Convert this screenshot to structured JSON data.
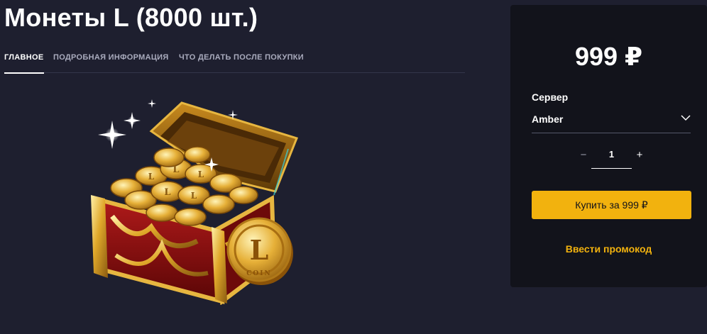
{
  "product": {
    "title": "Монеты L (8000 шт.)",
    "image_alt": "Сундук с монетами L"
  },
  "tabs": [
    {
      "label": "ГЛАВНОЕ",
      "active": true
    },
    {
      "label": "ПОДРОБНАЯ ИНФОРМАЦИЯ",
      "active": false
    },
    {
      "label": "ЧТО ДЕЛАТЬ ПОСЛЕ ПОКУПКИ",
      "active": false
    }
  ],
  "purchase": {
    "price": "999 ₽",
    "server_label": "Сервер",
    "server_value": "Amber",
    "quantity": "1",
    "minus": "−",
    "plus": "+",
    "buy_label": "Купить за 999 ₽",
    "promo_label": "Ввести промокод"
  },
  "colors": {
    "background": "#1e1f2f",
    "panel": "#12131b",
    "accent": "#f2b20e"
  }
}
